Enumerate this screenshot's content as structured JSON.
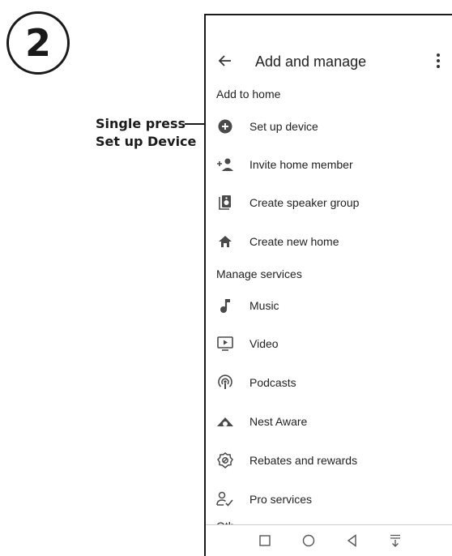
{
  "step": {
    "number": "2"
  },
  "callout": {
    "line1": "Single press",
    "line2": "Set up Device"
  },
  "header": {
    "title": "Add and manage"
  },
  "sections": {
    "add_to_home": "Add to home",
    "manage_services": "Manage services",
    "cutoff_label": "Oth"
  },
  "add_items": [
    {
      "label": "Set up device",
      "icon": "plus-circle-icon"
    },
    {
      "label": "Invite home member",
      "icon": "person-add-icon"
    },
    {
      "label": "Create speaker group",
      "icon": "speaker-icon"
    },
    {
      "label": "Create new home",
      "icon": "home-icon"
    }
  ],
  "manage_items": [
    {
      "label": "Music",
      "icon": "music-note-icon"
    },
    {
      "label": "Video",
      "icon": "video-icon"
    },
    {
      "label": "Podcasts",
      "icon": "podcast-icon"
    },
    {
      "label": "Nest Aware",
      "icon": "nest-aware-icon"
    },
    {
      "label": "Rebates and rewards",
      "icon": "rebate-icon"
    },
    {
      "label": "Pro services",
      "icon": "pro-services-icon"
    }
  ],
  "colors": {
    "icon": "#4a4a4a",
    "text": "#222222",
    "border": "#1a1a1a"
  }
}
